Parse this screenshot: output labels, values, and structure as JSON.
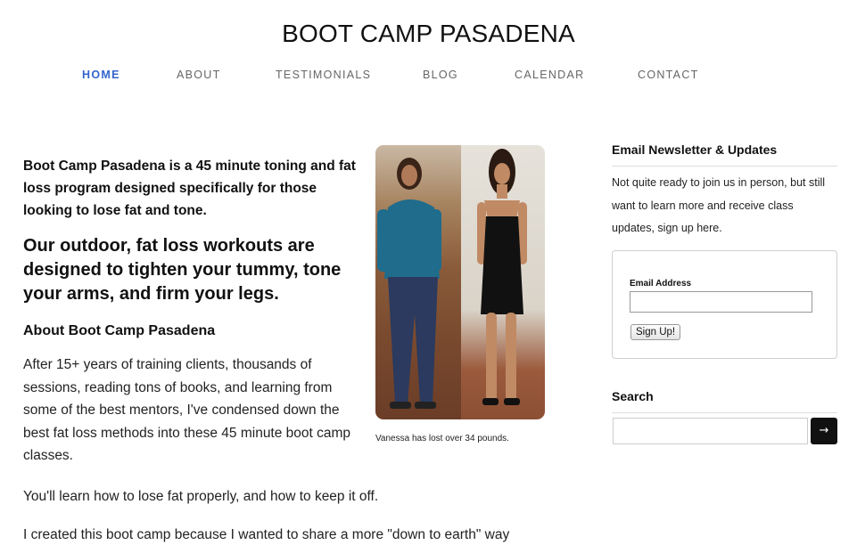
{
  "site": {
    "title": "BOOT CAMP PASADENA"
  },
  "nav": {
    "items": [
      {
        "label": "HOME",
        "active": true
      },
      {
        "label": "ABOUT"
      },
      {
        "label": "TESTIMONIALS"
      },
      {
        "label": "BLOG"
      },
      {
        "label": "CALENDAR"
      },
      {
        "label": "CONTACT"
      }
    ]
  },
  "main": {
    "intro": "Boot Camp Pasadena is a 45 minute toning and fat loss program designed specifically for those looking to lose fat and tone.",
    "headline": "Our outdoor, fat loss workouts are designed to tighten your tummy, tone your arms, and firm your legs.",
    "subhead": "About Boot Camp Pasadena",
    "para1": "After 15+ years of training clients, thousands of sessions, reading tons of books, and learning from some of the best mentors, I've condensed down the best fat loss methods into these 45 minute boot camp classes.",
    "para2": "You'll learn how to lose fat properly, and how to keep it off.",
    "para3": "I created this boot camp because I wanted to share a more \"down to earth\" way",
    "photo_caption": "Vanessa has lost over 34 pounds."
  },
  "sidebar": {
    "newsletter_title": "Email Newsletter & Updates",
    "newsletter_text": "Not quite ready to join us in person, but still want to learn more and receive class updates, sign up here.",
    "email_label": "Email Address",
    "email_value": "",
    "signup_label": "Sign Up!",
    "search_title": "Search",
    "search_value": "",
    "search_button": "→"
  },
  "colors": {
    "nav_active": "#3366cc",
    "nav_default": "#666666",
    "search_button_bg": "#111111"
  },
  "icons": {
    "search_button": "arrow-right-icon"
  }
}
